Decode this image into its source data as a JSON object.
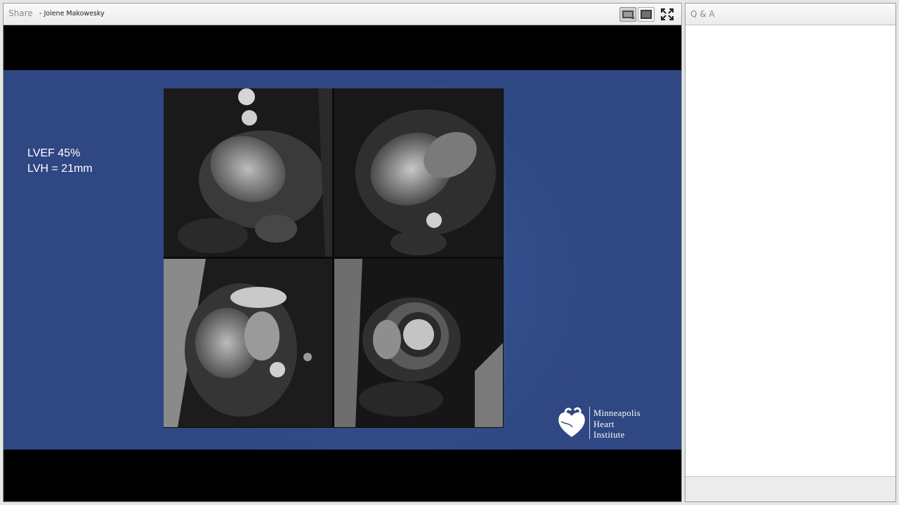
{
  "share_panel": {
    "title": "Share",
    "presenter": "- Jolene Makowesky",
    "buttons": [
      {
        "name": "view-layout-1",
        "icon": "monitor-icon"
      },
      {
        "name": "view-layout-2",
        "icon": "monitor-icon"
      },
      {
        "name": "fullscreen",
        "icon": "expand-icon"
      }
    ]
  },
  "slide": {
    "lines": [
      "LVEF 45%",
      "LVH = 21mm"
    ],
    "logo": {
      "lines": [
        "Minneapolis",
        "Heart",
        "Institute"
      ],
      "icon": "heart-logo-icon"
    },
    "background_color": "#354f8c"
  },
  "qa_panel": {
    "title": "Q & A"
  }
}
